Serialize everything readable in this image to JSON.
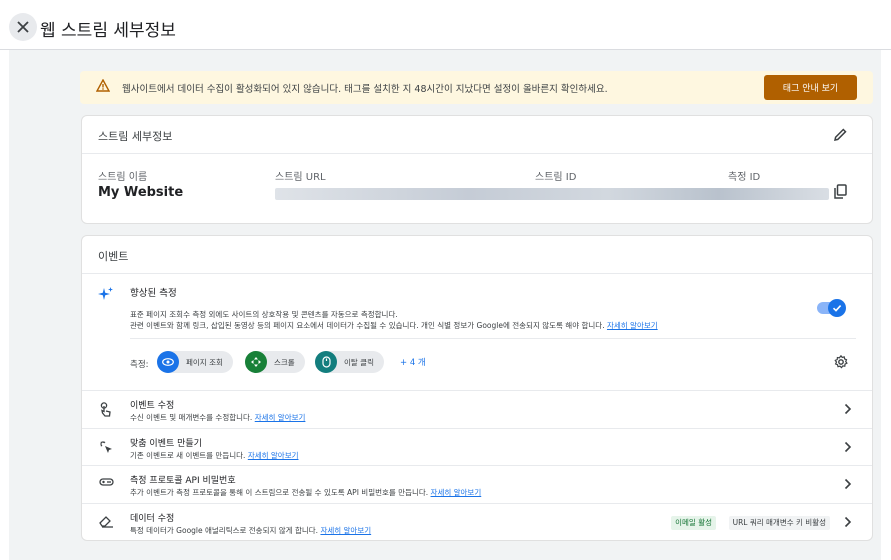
{
  "header": {
    "title": "웹 스트림 세부정보"
  },
  "banner": {
    "text": "웹사이트에서 데이터 수집이 활성화되어 있지 않습니다. 태그를 설치한 지 48시간이 지났다면 설정이 올바른지 확인하세요.",
    "button_label": "태그 안내 보기"
  },
  "stream_details": {
    "title": "스트림 세부정보",
    "name_label": "스트림 이름",
    "name_value": "My Website",
    "url_label": "스트림 URL",
    "id_label": "스트림 ID",
    "measurement_id_label": "측정 ID"
  },
  "events": {
    "title": "이벤트",
    "enhanced": {
      "title": "향상된 측정",
      "desc_line1": "표준 페이지 조회수 측정 외에도 사이트의 상호작용 및 콘텐츠를 자동으로 측정합니다.",
      "desc_line2": "관련 이벤트와 함께 링크, 삽입된 동영상 등의 페이지 요소에서 데이터가 수집될 수 있습니다. 개인 식별 정보가 Google에 전송되지 않도록 해야 합니다.",
      "learn_more": "자세히 알아보기",
      "toggle_on": true,
      "measure_label": "측정:",
      "chips": [
        {
          "label": "페이지 조회",
          "color": "#1a73e8",
          "icon": "eye-icon"
        },
        {
          "label": "스크롤",
          "color": "#188038",
          "icon": "scroll-icon"
        },
        {
          "label": "이탈 클릭",
          "color": "#137e7e",
          "icon": "mouse-icon"
        }
      ],
      "more": "+ 4 개"
    },
    "rows": [
      {
        "title": "이벤트 수정",
        "desc": "수신 이벤트 및 매개변수를 수정합니다.",
        "link": "자세히 알아보기"
      },
      {
        "title": "맞춤 이벤트 만들기",
        "desc": "기존 이벤트로 새 이벤트를 만듭니다.",
        "link": "자세히 알아보기"
      },
      {
        "title": "측정 프로토콜 API 비밀번호",
        "desc": "추가 이벤트가 측정 프로토콜을 통해 이 스트림으로 전송될 수 있도록 API 비밀번호를 만듭니다.",
        "link": "자세히 알아보기"
      },
      {
        "title": "데이터 수정",
        "desc": "특정 데이터가 Google 애널리틱스로 전송되지 않게 합니다.",
        "link": "자세히 알아보기",
        "badge_active": "이메일 활성",
        "badge_inactive": "URL 쿼리 매개변수 키 비활성"
      }
    ]
  },
  "colors": {
    "warning_button": "#b06000",
    "accent": "#1a73e8",
    "banner_bg": "#fef7e0"
  }
}
